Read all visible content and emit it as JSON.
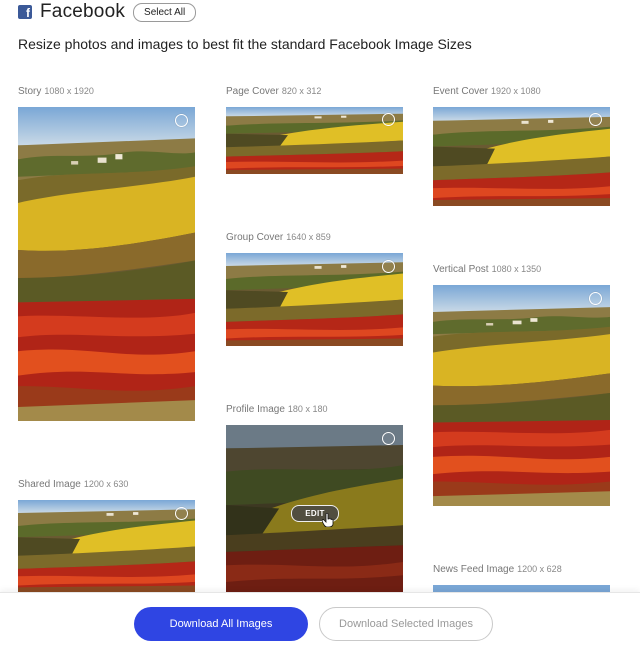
{
  "header": {
    "title": "Facebook",
    "select_all_label": "Select All",
    "subtitle": "Resize photos and images to best fit the standard Facebook Image Sizes"
  },
  "cards": {
    "story": {
      "name": "Story",
      "size": "1080 x 1920"
    },
    "page_cover": {
      "name": "Page Cover",
      "size": "820 x 312"
    },
    "event_cover": {
      "name": "Event Cover",
      "size": "1920 x 1080"
    },
    "group_cover": {
      "name": "Group Cover",
      "size": "1640 x 859"
    },
    "vertical_post": {
      "name": "Vertical Post",
      "size": "1080 x 1350"
    },
    "profile_image": {
      "name": "Profile Image",
      "size": "180 x 180",
      "edit_label": "EDIT"
    },
    "shared_image": {
      "name": "Shared Image",
      "size": "1200 x 630"
    },
    "news_feed_image": {
      "name": "News Feed Image",
      "size": "1200 x 628"
    }
  },
  "footer": {
    "download_all_label": "Download All Images",
    "download_selected_label": "Download Selected Images"
  },
  "colors": {
    "accent": "#2f45e3",
    "facebook_blue": "#3b5998"
  },
  "icons": {
    "brand": "facebook-icon",
    "select": "select-circle-icon",
    "cursor": "hand-pointer-icon"
  }
}
